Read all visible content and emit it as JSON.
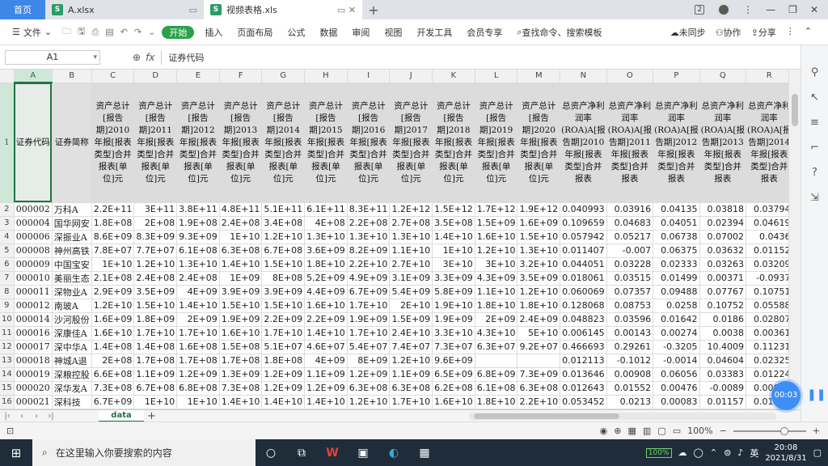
{
  "tabs": {
    "home": "首页",
    "file_a": "A.xlsx",
    "file_b": "视频表格.xls",
    "add": "+"
  },
  "window": {
    "page_badge": "2"
  },
  "menu": {
    "file": "文件",
    "items": [
      "开始",
      "插入",
      "页面布局",
      "公式",
      "数据",
      "审阅",
      "视图",
      "开发工具",
      "会员专享"
    ],
    "search": "查找命令、搜索模板",
    "sync": "未同步",
    "collab": "协作",
    "share": "分享"
  },
  "formula_bar": {
    "cell_ref": "A1",
    "fx": "fx",
    "content": "证券代码"
  },
  "columns": [
    "A",
    "B",
    "C",
    "D",
    "E",
    "F",
    "G",
    "H",
    "I",
    "J",
    "K",
    "L",
    "M",
    "N",
    "O",
    "P",
    "Q",
    "R",
    "S"
  ],
  "header_row": {
    "row_num": "1",
    "cells": [
      "证券代码",
      "证券简称",
      "资产总计[报告期]2010年报[报表类型]合并报表[单位]元",
      "资产总计[报告期]2011年报[报表类型]合并报表[单位]元",
      "资产总计[报告期]2012年报[报表类型]合并报表[单位]元",
      "资产总计[报告期]2013年报[报表类型]合并报表[单位]元",
      "资产总计[报告期]2014年报[报表类型]合并报表[单位]元",
      "资产总计[报告期]2015年报[报表类型]合并报表[单位]元",
      "资产总计[报告期]2016年报[报表类型]合并报表[单位]元",
      "资产总计[报告期]2017年报[报表类型]合并报表[单位]元",
      "资产总计[报告期]2018年报[报表类型]合并报表[单位]元",
      "资产总计[报告期]2019年报[报表类型]合并报表[单位]元",
      "资产总计[报告期]2020年报[报表类型]合并报表[单位]元",
      "总资产净利润率(ROA)A[报告期]2010年报[报表类型]合并报表",
      "总资产净利润率(ROA)A[报告期]2011年报[报表类型]合并报表",
      "总资产净利润率(ROA)A[报告期]2012年报[报表类型]合并报表",
      "总资产净利润率(ROA)A[报告期]2013年报[报表类型]合并报表",
      "总资产净利润率(ROA)A[报告期]2014年报[报表类型]合并报表",
      "总资"
    ]
  },
  "rows": [
    {
      "n": "2",
      "cells": [
        "000002",
        "万科A",
        "2.2E+11",
        "3E+11",
        "3.8E+11",
        "4.8E+11",
        "5.1E+11",
        "6.1E+11",
        "8.3E+11",
        "1.2E+12",
        "1.5E+12",
        "1.7E+12",
        "1.9E+12",
        "0.040993",
        "0.03916",
        "0.04135",
        "0.03818",
        "0.03794",
        "0"
      ]
    },
    {
      "n": "3",
      "cells": [
        "000004",
        "国华网安",
        "1.8E+08",
        "2E+08",
        "1.9E+08",
        "2.4E+08",
        "3.4E+08",
        "4E+08",
        "2.2E+08",
        "2.7E+08",
        "3.5E+08",
        "1.5E+09",
        "1.6E+09",
        "0.109659",
        "0.04683",
        "0.04051",
        "0.02394",
        "0.04619",
        "0"
      ]
    },
    {
      "n": "4",
      "cells": [
        "000006",
        "深振业A",
        "8.6E+09",
        "8.3E+09",
        "9.3E+09",
        "1E+10",
        "1.2E+10",
        "1.3E+10",
        "1.3E+10",
        "1.3E+10",
        "1.4E+10",
        "1.6E+10",
        "1.5E+10",
        "0.057942",
        "0.05217",
        "0.06738",
        "0.07002",
        "0.0436",
        "0"
      ]
    },
    {
      "n": "5",
      "cells": [
        "000008",
        "神州高铁",
        "7.8E+07",
        "7.7E+07",
        "6.1E+08",
        "6.3E+08",
        "6.7E+08",
        "3.6E+09",
        "8.2E+09",
        "1.1E+10",
        "1E+10",
        "1.2E+10",
        "1.3E+10",
        "0.011407",
        "-0.007",
        "0.06375",
        "0.03632",
        "0.01152",
        "0"
      ]
    },
    {
      "n": "6",
      "cells": [
        "000009",
        "中国宝安",
        "1E+10",
        "1.2E+10",
        "1.3E+10",
        "1.4E+10",
        "1.5E+10",
        "1.8E+10",
        "2.2E+10",
        "2.7E+10",
        "3E+10",
        "3E+10",
        "3.2E+10",
        "0.044051",
        "0.03228",
        "0.02333",
        "0.03263",
        "0.03209",
        "0"
      ]
    },
    {
      "n": "7",
      "cells": [
        "000010",
        "美丽生态",
        "2.1E+08",
        "2.4E+08",
        "2.4E+08",
        "1E+09",
        "8E+08",
        "5.2E+09",
        "4.9E+09",
        "3.1E+09",
        "3.3E+09",
        "4.3E+09",
        "3.5E+09",
        "0.018061",
        "0.03515",
        "0.01499",
        "0.00371",
        "-0.0937",
        "0"
      ]
    },
    {
      "n": "8",
      "cells": [
        "000011",
        "深物业A",
        "2.9E+09",
        "3.5E+09",
        "4E+09",
        "3.9E+09",
        "3.9E+09",
        "4.4E+09",
        "6.7E+09",
        "5.4E+09",
        "5.8E+09",
        "1.1E+10",
        "1.2E+10",
        "0.060069",
        "0.07357",
        "0.09488",
        "0.07767",
        "0.10751",
        "0"
      ]
    },
    {
      "n": "9",
      "cells": [
        "000012",
        "南玻A",
        "1.2E+10",
        "1.5E+10",
        "1.4E+10",
        "1.5E+10",
        "1.5E+10",
        "1.6E+10",
        "1.7E+10",
        "2E+10",
        "1.9E+10",
        "1.8E+10",
        "1.8E+10",
        "0.128068",
        "0.08753",
        "0.0258",
        "0.10752",
        "0.05588",
        "0"
      ]
    },
    {
      "n": "10",
      "cells": [
        "000014",
        "沙河股份",
        "1.6E+09",
        "1.8E+09",
        "2E+09",
        "1.9E+09",
        "2.2E+09",
        "2.2E+09",
        "1.9E+09",
        "1.5E+09",
        "1.9E+09",
        "2E+09",
        "2.4E+09",
        "0.048823",
        "0.03596",
        "0.01642",
        "0.0186",
        "0.02807",
        "0"
      ]
    },
    {
      "n": "11",
      "cells": [
        "000016",
        "深康佳A",
        "1.6E+10",
        "1.7E+10",
        "1.7E+10",
        "1.6E+10",
        "1.7E+10",
        "1.4E+10",
        "1.7E+10",
        "2.4E+10",
        "3.3E+10",
        "4.3E+10",
        "5E+10",
        "0.006145",
        "0.00143",
        "0.00274",
        "0.0038",
        "0.00361",
        "-"
      ]
    },
    {
      "n": "12",
      "cells": [
        "000017",
        "深中华A",
        "1.4E+08",
        "1.4E+08",
        "1.6E+08",
        "1.5E+08",
        "5.1E+07",
        "4.6E+07",
        "5.4E+07",
        "7.4E+07",
        "7.3E+07",
        "6.3E+07",
        "9.2E+07",
        "0.466693",
        "0.29261",
        "-0.3205",
        "10.4009",
        "0.11231",
        "-"
      ]
    },
    {
      "n": "13",
      "cells": [
        "000018",
        "神城A退",
        "2E+08",
        "1.7E+08",
        "1.7E+08",
        "1.7E+08",
        "1.8E+08",
        "4E+09",
        "8E+09",
        "1.2E+10",
        "9.6E+09",
        "",
        "",
        "0.012113",
        "-0.1012",
        "-0.0014",
        "0.04604",
        "0.02325",
        "0"
      ]
    },
    {
      "n": "14",
      "cells": [
        "000019",
        "深粮控股",
        "6.6E+08",
        "1.1E+09",
        "1.2E+09",
        "1.3E+09",
        "1.2E+09",
        "1.1E+09",
        "1.2E+09",
        "1.1E+09",
        "6.5E+09",
        "6.8E+09",
        "7.3E+09",
        "0.013646",
        "0.00908",
        "0.06056",
        "0.03383",
        "0.01224",
        "-"
      ]
    },
    {
      "n": "15",
      "cells": [
        "000020",
        "深华发A",
        "7.3E+08",
        "6.7E+08",
        "6.8E+08",
        "7.3E+08",
        "1.2E+09",
        "1.2E+09",
        "6.3E+08",
        "6.3E+08",
        "6.2E+08",
        "6.1E+08",
        "6.3E+08",
        "0.012643",
        "0.01552",
        "0.00476",
        "-0.0089",
        "0.00661",
        "-"
      ]
    },
    {
      "n": "16",
      "cells": [
        "000021",
        "深科技",
        "6.7E+09",
        "1E+10",
        "1E+10",
        "1.4E+10",
        "1.4E+10",
        "1.4E+10",
        "1.2E+10",
        "1.7E+10",
        "1.6E+10",
        "1.8E+10",
        "2.2E+10",
        "0.053452",
        "0.0213",
        "0.00083",
        "0.01157",
        "0.01111",
        "0"
      ]
    },
    {
      "n": "17",
      "cells": [
        "000022",
        "深赤湾A",
        "6.2E+09",
        "6.5E+09",
        "6.8E+09",
        "7.3E+09",
        "6.9E+09",
        "6.9E+09",
        "6.6E+09",
        "8E+09",
        "",
        "",
        "",
        "0.133282",
        "0.1021",
        "0.09081",
        "0.08745",
        "0.0763",
        ""
      ]
    },
    {
      "n": "18",
      "cells": [
        "000023",
        "深天地A",
        "9.4E+08",
        "1.1E+09",
        "1.2E+09",
        "1.3E+09",
        "1.5E+09",
        "1.6E+09",
        "1.5E+09",
        "2E+09",
        "2.3E+09",
        "2.5E+09",
        "2.3E+09",
        "0.013908",
        "0.00832",
        "0.00421",
        "0.00879",
        "0.0102",
        ""
      ]
    }
  ],
  "sheet": {
    "name": "data",
    "add": "+"
  },
  "status": {
    "zoom": "100%",
    "timer": "00:03"
  },
  "taskbar": {
    "search": "在这里输入你要搜索的内容",
    "battery": "100%",
    "ime": "英",
    "time": "20:08",
    "date": "2021/8/31"
  }
}
